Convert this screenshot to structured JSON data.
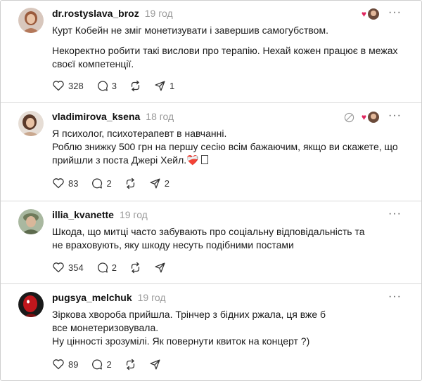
{
  "posts": [
    {
      "username": "dr.rostyslava_broz",
      "time": "19 год",
      "text": [
        "Курт Кобейн не зміг монетизувати і завершив самогубством.",
        "Некоректно робити такі вислови про терапію. Нехай кожен працює в межах своєї компетенції."
      ],
      "likes": "328",
      "replies": "3",
      "reposts": "",
      "shares": "1"
    },
    {
      "username": "vladimirova_ksena",
      "time": "18 год",
      "text_lines": [
        "Я психолог, психотерапевт в навчанні.",
        "Роблю знижку 500 грн на першу сесію всім бажаючим, якщо ви скажете, що прийшли з поста Джері Хейл."
      ],
      "emoji": "❤️‍🩹",
      "likes": "83",
      "replies": "2",
      "reposts": "",
      "shares": "2"
    },
    {
      "username": "illia_kvanette",
      "time": "19 год",
      "text": [
        "Шкода, що митці часто забувають про соціальну відповідальність та не враховують, яку шкоду несуть подібними постами"
      ],
      "likes": "354",
      "replies": "2",
      "reposts": "",
      "shares": ""
    },
    {
      "username": "pugsya_melchuk",
      "time": "19 год",
      "text_lines": [
        "Зіркова хвороба прийшла. Трінчер з бідних ржала, ця вже б",
        "все монетеризовувала.",
        "Ну цінності зрозумілі. Як повернути квиток на концерт ?)"
      ],
      "likes": "89",
      "replies": "2",
      "reposts": "",
      "shares": ""
    }
  ],
  "more_label": "···",
  "icons": [
    "heart-icon",
    "comment-icon",
    "repost-icon",
    "share-icon",
    "more-icon",
    "mute-icon"
  ],
  "colors": {
    "text": "#1a1a1a",
    "muted": "#9a9a9a",
    "divider": "#d9d9d9",
    "heart": "#b3122e"
  }
}
